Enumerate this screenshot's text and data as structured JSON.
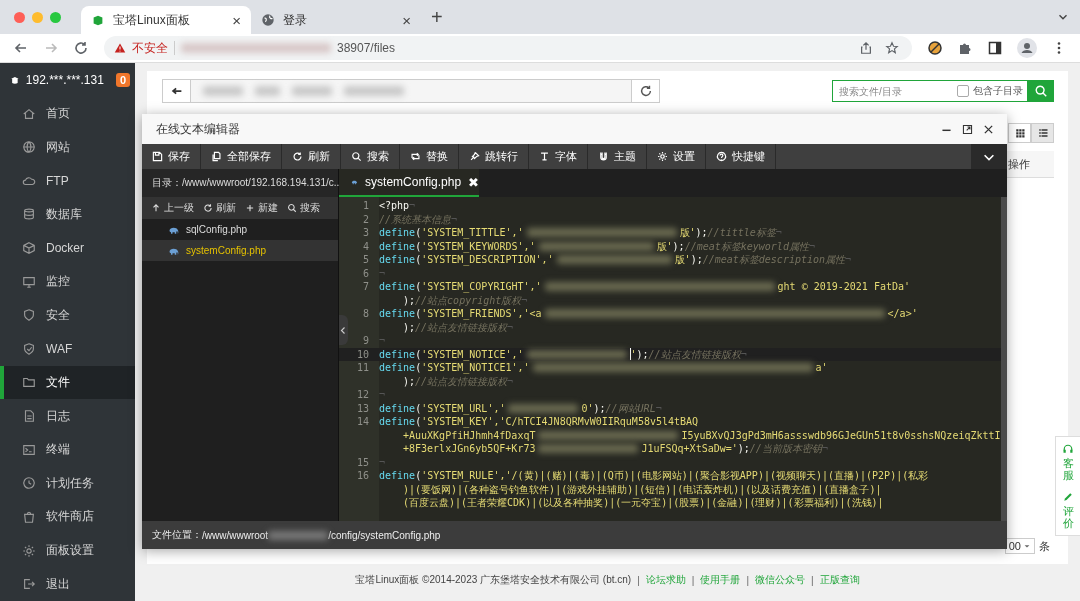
{
  "browser": {
    "tabs": [
      {
        "title": "宝塔Linux面板",
        "selected": true,
        "close": "×"
      },
      {
        "title": "登录",
        "selected": false,
        "close": "×"
      }
    ],
    "new_tab": "+",
    "security": "不安全",
    "url_visible": "38907/files"
  },
  "sidebar": {
    "host": "192.***.***.131",
    "badge": "0",
    "items": [
      {
        "label": "首页",
        "selected": false
      },
      {
        "label": "网站",
        "selected": false
      },
      {
        "label": "FTP",
        "selected": false
      },
      {
        "label": "数据库",
        "selected": false
      },
      {
        "label": "Docker",
        "selected": false
      },
      {
        "label": "监控",
        "selected": false
      },
      {
        "label": "安全",
        "selected": false
      },
      {
        "label": "WAF",
        "selected": false
      },
      {
        "label": "文件",
        "selected": true
      },
      {
        "label": "日志",
        "selected": false
      },
      {
        "label": "终端",
        "selected": false
      },
      {
        "label": "计划任务",
        "selected": false
      },
      {
        "label": "软件商店",
        "selected": false
      },
      {
        "label": "面板设置",
        "selected": false
      },
      {
        "label": "退出",
        "selected": false
      }
    ]
  },
  "files": {
    "search": {
      "placeholder": "搜索文件/目录",
      "subdir_label": "包含子目录",
      "subdir_checked": false
    },
    "views": [
      {
        "kind": "grid",
        "selected": false
      },
      {
        "kind": "list",
        "selected": true
      }
    ],
    "column_header": "操作",
    "page_size": "00",
    "page_unit": "条"
  },
  "editor": {
    "title": "在线文本编辑器",
    "toolbar": [
      "保存",
      "全部保存",
      "刷新",
      "搜索",
      "替换",
      "跳转行",
      "字体",
      "主题",
      "设置",
      "快捷键"
    ],
    "directory": "目录：/www/wwwroot/192.168.194.131/c...",
    "tree_actions": [
      "上一级",
      "刷新",
      "新建",
      "搜索"
    ],
    "files": [
      {
        "name": "sqlConfig.php",
        "selected": false
      },
      {
        "name": "systemConfig.php",
        "selected": true
      }
    ],
    "tab": {
      "name": "systemConfig.php",
      "close": "✖"
    },
    "rows": [
      {
        "number": "1",
        "current": false,
        "segments": [
          {
            "kind": "tag",
            "text": "<?php"
          },
          {
            "kind": "eol",
            "text": "¬"
          }
        ]
      },
      {
        "number": "2",
        "current": false,
        "segments": [
          {
            "kind": "comment",
            "text": "//系统基本信息"
          },
          {
            "kind": "eol",
            "text": "¬"
          }
        ]
      },
      {
        "number": "3",
        "current": false,
        "segments": [
          {
            "kind": "function",
            "text": "define"
          },
          {
            "kind": "punct",
            "text": "("
          },
          {
            "kind": "string",
            "text": "'SYSTEM_TITTLE','"
          },
          {
            "kind": "blur"
          },
          {
            "kind": "string",
            "text": "版'"
          },
          {
            "kind": "punct",
            "text": ");"
          },
          {
            "kind": "comment",
            "text": "//tittle标签"
          },
          {
            "kind": "eol",
            "text": "¬"
          }
        ]
      },
      {
        "number": "4",
        "current": false,
        "segments": [
          {
            "kind": "function",
            "text": "define"
          },
          {
            "kind": "punct",
            "text": "("
          },
          {
            "kind": "string",
            "text": "'SYSTEM_KEYWORDS','"
          },
          {
            "kind": "blur"
          },
          {
            "kind": "string",
            "text": "版'"
          },
          {
            "kind": "punct",
            "text": ");"
          },
          {
            "kind": "comment",
            "text": "//meat标签keyworld属性"
          },
          {
            "kind": "eol",
            "text": "¬"
          }
        ]
      },
      {
        "number": "5",
        "current": false,
        "segments": [
          {
            "kind": "function",
            "text": "define"
          },
          {
            "kind": "punct",
            "text": "("
          },
          {
            "kind": "string",
            "text": "'SYSTEM_DESCRIPTION','"
          },
          {
            "kind": "blur"
          },
          {
            "kind": "string",
            "text": "版'"
          },
          {
            "kind": "punct",
            "text": ");"
          },
          {
            "kind": "comment",
            "text": "//meat标签description属性"
          },
          {
            "kind": "eol",
            "text": "¬"
          }
        ]
      },
      {
        "number": "6",
        "current": false,
        "segments": [
          {
            "kind": "eol",
            "text": "¬"
          }
        ]
      },
      {
        "number": "7",
        "current": false,
        "segments": [
          {
            "kind": "function",
            "text": "define"
          },
          {
            "kind": "punct",
            "text": "("
          },
          {
            "kind": "string",
            "text": "'SYSTEM_COPYRIGHT','"
          },
          {
            "kind": "blur"
          },
          {
            "kind": "string",
            "text": "ght © 2019-2021 FatDa'"
          }
        ]
      },
      {
        "current": false,
        "segments": [
          {
            "kind": "punct",
            "text": ");"
          },
          {
            "kind": "comment",
            "text": "//站点copyright版权"
          },
          {
            "kind": "eol",
            "text": "¬"
          }
        ]
      },
      {
        "number": "8",
        "current": false,
        "segments": [
          {
            "kind": "function",
            "text": "define"
          },
          {
            "kind": "punct",
            "text": "("
          },
          {
            "kind": "string",
            "text": "'SYSTEM_FRIENDS','<a"
          },
          {
            "kind": "blur"
          },
          {
            "kind": "string",
            "text": "</a>'"
          }
        ]
      },
      {
        "current": false,
        "segments": [
          {
            "kind": "punct",
            "text": ");"
          },
          {
            "kind": "comment",
            "text": "//站点友情链接版权"
          },
          {
            "kind": "eol",
            "text": "¬"
          }
        ]
      },
      {
        "number": "9",
        "current": false,
        "segments": [
          {
            "kind": "eol",
            "text": "¬"
          }
        ]
      },
      {
        "number": "10",
        "current": true,
        "segments": [
          {
            "kind": "function",
            "text": "define"
          },
          {
            "kind": "punct",
            "text": "("
          },
          {
            "kind": "string",
            "text": "'SYSTEM_NOTICE','"
          },
          {
            "kind": "blur"
          },
          {
            "kind": "string",
            "text": "'"
          },
          {
            "kind": "punct",
            "text": ");"
          },
          {
            "kind": "comment",
            "text": "//站点友情链接版权"
          },
          {
            "kind": "eol",
            "text": "¬"
          }
        ]
      },
      {
        "number": "11",
        "current": false,
        "segments": [
          {
            "kind": "function",
            "text": "define"
          },
          {
            "kind": "punct",
            "text": "("
          },
          {
            "kind": "string",
            "text": "'SYSTEM_NOTICE1','"
          },
          {
            "kind": "blur"
          },
          {
            "kind": "string",
            "text": "a'"
          }
        ]
      },
      {
        "current": false,
        "segments": [
          {
            "kind": "punct",
            "text": ");"
          },
          {
            "kind": "comment",
            "text": "//站点友情链接版权"
          },
          {
            "kind": "eol",
            "text": "¬"
          }
        ]
      },
      {
        "number": "12",
        "current": false,
        "segments": [
          {
            "kind": "eol",
            "text": "¬"
          }
        ]
      },
      {
        "number": "13",
        "current": false,
        "segments": [
          {
            "kind": "function",
            "text": "define"
          },
          {
            "kind": "punct",
            "text": "("
          },
          {
            "kind": "string",
            "text": "'SYSTEM_URL','"
          },
          {
            "kind": "blur"
          },
          {
            "kind": "string",
            "text": "0'"
          },
          {
            "kind": "punct",
            "text": ");"
          },
          {
            "kind": "comment",
            "text": "//网站URL"
          },
          {
            "kind": "eol",
            "text": "¬"
          }
        ]
      },
      {
        "number": "14",
        "current": false,
        "segments": [
          {
            "kind": "function",
            "text": "define"
          },
          {
            "kind": "punct",
            "text": "("
          },
          {
            "kind": "string",
            "text": "'SYSTEM_KEY','C/hTCI4JN8QRMvW0IIRquM58v5l4tBAQ"
          }
        ]
      },
      {
        "current": false,
        "segments": [
          {
            "kind": "string",
            "text": "+AuuXKgPfiHJhmh4fDaxqT"
          },
          {
            "kind": "blur"
          },
          {
            "kind": "string",
            "text": "I5yuBXvQJ3gPd3mH6assswdb96GJeGUn51t8v0sshsNQzeiqZkttI"
          }
        ]
      },
      {
        "current": false,
        "segments": [
          {
            "kind": "string",
            "text": "+8F3erlxJGn6yb5QF+Kr73"
          },
          {
            "kind": "blur"
          },
          {
            "kind": "string",
            "text": "J1uFSQq+XtSaDw='"
          },
          {
            "kind": "punct",
            "text": ");"
          },
          {
            "kind": "comment",
            "text": "//当前版本密钥"
          },
          {
            "kind": "eol",
            "text": "¬"
          }
        ]
      },
      {
        "number": "15",
        "current": false,
        "segments": [
          {
            "kind": "eol",
            "text": "¬"
          }
        ]
      },
      {
        "number": "16",
        "current": false,
        "segments": [
          {
            "kind": "function",
            "text": "define"
          },
          {
            "kind": "punct",
            "text": "("
          },
          {
            "kind": "string",
            "text": "'SYSTEM_RULE','/(黄)|(赌)|(毒)|(Q币)|(电影网站)|(聚合影视APP)|(视频聊天)|(直播)|(P2P)|(私彩"
          }
        ]
      },
      {
        "current": false,
        "segments": [
          {
            "kind": "string",
            "text": ")|(要饭网)|(各种盗号钓鱼软件)|(游戏外挂辅助)|(短信)|(电话轰炸机)|(以及话费充值)|(直播盒子)|"
          }
        ]
      },
      {
        "current": false,
        "segments": [
          {
            "kind": "string",
            "text": "(百度云盘)|(王者荣耀CDK)|(以及各种抽奖)|(一元夺宝)|(股票)|(金融)|(理财)|(彩票福利)|(洗钱)|"
          }
        ]
      }
    ],
    "status_label": "文件位置：",
    "status_path_start": "/www/wwwroot",
    "status_path_end": "/config/systemConfig.php"
  },
  "side_widget": [
    "客服",
    "评价"
  ],
  "footer": {
    "copyright": "宝塔Linux面板 ©2014-2023 广东堡塔安全技术有限公司 (bt.cn)",
    "links": [
      {
        "separator": "|",
        "label": "论坛求助"
      },
      {
        "separator": "|",
        "label": "使用手册"
      },
      {
        "separator": "|",
        "label": "微信公众号"
      },
      {
        "separator": "|",
        "label": "正版查询"
      }
    ]
  }
}
